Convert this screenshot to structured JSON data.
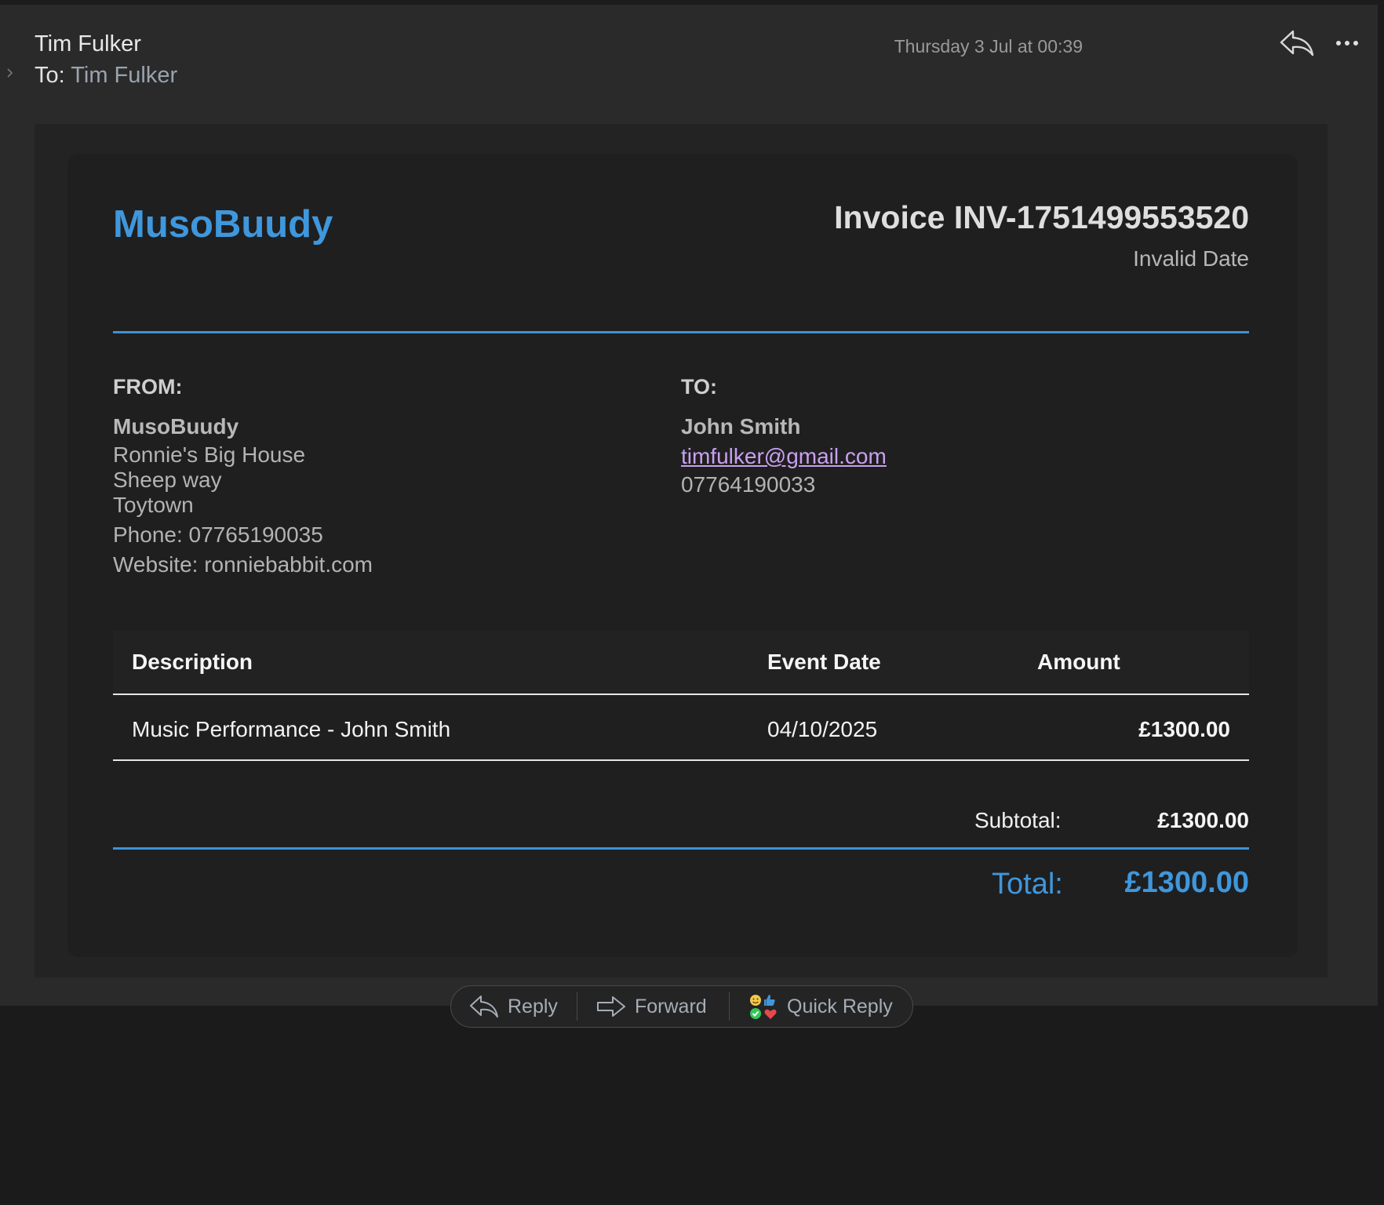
{
  "header": {
    "sender": "Tim Fulker",
    "to_label": "To:",
    "recipient": "Tim Fulker",
    "date": "Thursday 3 Jul at 00:39"
  },
  "invoice": {
    "brand": "MusoBuudy",
    "title": "Invoice INV-1751499553520",
    "date": "Invalid Date",
    "from": {
      "label": "FROM:",
      "name": "MusoBuudy",
      "address": [
        "Ronnie's Big House",
        "Sheep way",
        "Toytown"
      ],
      "phone": "Phone: 07765190035",
      "website": "Website: ronniebabbit.com"
    },
    "to": {
      "label": "TO:",
      "name": "John Smith",
      "email": "timfulker@gmail.com",
      "phone": "07764190033"
    },
    "table": {
      "columns": [
        "Description",
        "Event Date",
        "Amount"
      ],
      "rows": [
        {
          "description": "Music Performance - John Smith",
          "event_date": "04/10/2025",
          "amount": "£1300.00"
        }
      ]
    },
    "subtotal_label": "Subtotal:",
    "subtotal_value": "£1300.00",
    "total_label": "Total:",
    "total_value": "£1300.00"
  },
  "actions": {
    "reply": "Reply",
    "forward": "Forward",
    "quick_reply": "Quick Reply"
  },
  "colors": {
    "accent": "#3f97dc",
    "link": "#c9a0ef",
    "background": "#2a2a2b"
  }
}
